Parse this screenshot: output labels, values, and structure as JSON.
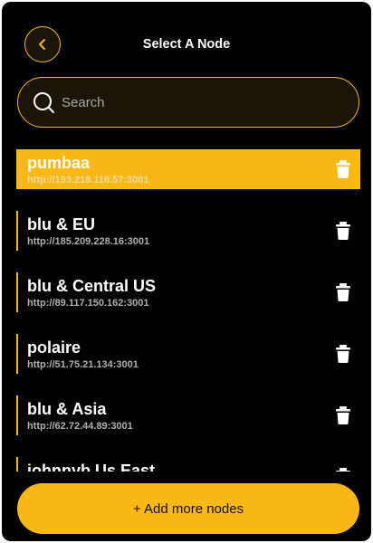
{
  "header": {
    "title": "Select A Node",
    "back_icon": "chevron-left-icon"
  },
  "search": {
    "placeholder": "Search",
    "value": "",
    "icon": "search-icon"
  },
  "nodes": [
    {
      "name": "pumbaa",
      "url": "http://193.218.118.57:3001",
      "selected": true
    },
    {
      "name": "blu & EU",
      "url": "http://185.209.228.16:3001",
      "selected": false
    },
    {
      "name": "blu & Central US",
      "url": "http://89.117.150.162:3001",
      "selected": false
    },
    {
      "name": "polaire",
      "url": "http://51.75.21.134:3001",
      "selected": false
    },
    {
      "name": "blu & Asia",
      "url": "http://62.72.44.89:3001",
      "selected": false
    },
    {
      "name": "johnnyb Us East",
      "url": "",
      "selected": false
    }
  ],
  "footer": {
    "add_label": "+ Add more nodes"
  },
  "colors": {
    "accent": "#f9b815",
    "background": "#000000",
    "text": "#ffffff",
    "muted_text": "#b0b0b0"
  }
}
